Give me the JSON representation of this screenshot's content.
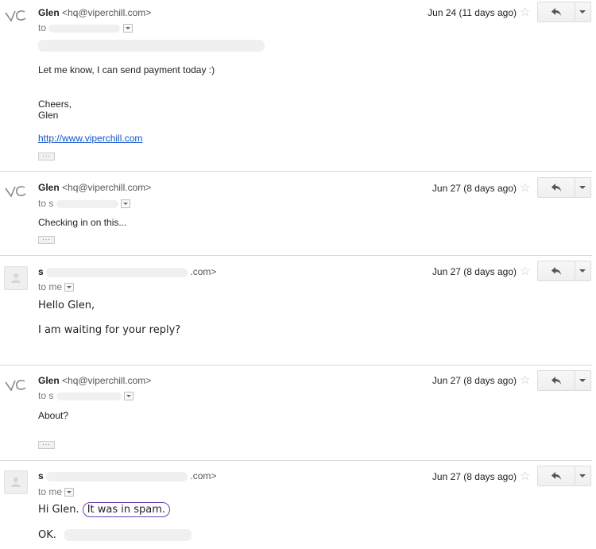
{
  "messages": [
    {
      "sender_name": "Glen",
      "sender_email": "<hq@viperchill.com>",
      "to_prefix": "to",
      "date": "Jun 24 (11 days ago)",
      "lines": [
        "Let me know, I can send payment today :)",
        "Cheers,",
        "Glen"
      ],
      "link": "http://www.viperchill.com",
      "ellipsis": "..."
    },
    {
      "sender_name": "Glen",
      "sender_email": "<hq@viperchill.com>",
      "to_prefix": "to s",
      "date": "Jun 27 (8 days ago)",
      "lines": [
        "Checking in on this..."
      ],
      "ellipsis": "..."
    },
    {
      "sender_name": "s",
      "sender_email_suffix": ".com>",
      "to_prefix": "to me",
      "date": "Jun 27 (8 days ago)",
      "lines": [
        "Hello Glen,",
        "I am waiting for your reply?"
      ]
    },
    {
      "sender_name": "Glen",
      "sender_email": "<hq@viperchill.com>",
      "to_prefix": "to s",
      "date": "Jun 27 (8 days ago)",
      "lines": [
        "About?"
      ],
      "ellipsis": "..."
    },
    {
      "sender_name": "s",
      "sender_email_suffix": ".com>",
      "to_prefix": "to me",
      "date": "Jun 27 (8 days ago)",
      "greeting": "Hi Glen.",
      "highlight": "It was in spam.",
      "lines": [
        "OK."
      ]
    }
  ],
  "icons": {
    "star": "star-icon",
    "reply": "reply-arrow-icon",
    "more": "chevron-down-icon"
  },
  "colors": {
    "link": "#1155cc",
    "highlight_circle": "#6a3fb5",
    "divider": "#d9d9d9"
  }
}
